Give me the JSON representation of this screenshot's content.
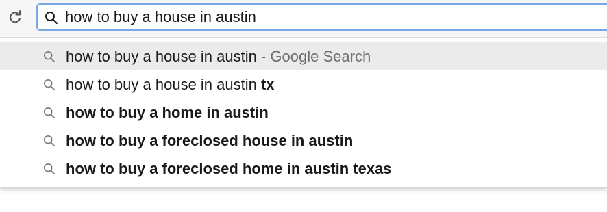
{
  "toolbar": {
    "reload_icon": "reload-icon",
    "omnibox": {
      "icon": "search-icon",
      "value": "how to buy a house in austin"
    }
  },
  "suggestions": [
    {
      "plain": "how to buy a house in austin",
      "separator": " - ",
      "suffix": "Google Search",
      "selected": true
    },
    {
      "plain": "how to buy a house in austin ",
      "bold": "tx"
    },
    {
      "bold": "how to buy a home in austin"
    },
    {
      "bold": "how to buy a foreclosed house in austin"
    },
    {
      "bold": "how to buy a foreclosed home in austin texas"
    }
  ],
  "colors": {
    "omnibox_focus_border": "#7aa7e6",
    "selected_row": "#ebebeb",
    "muted_text": "#6f6f6f"
  }
}
